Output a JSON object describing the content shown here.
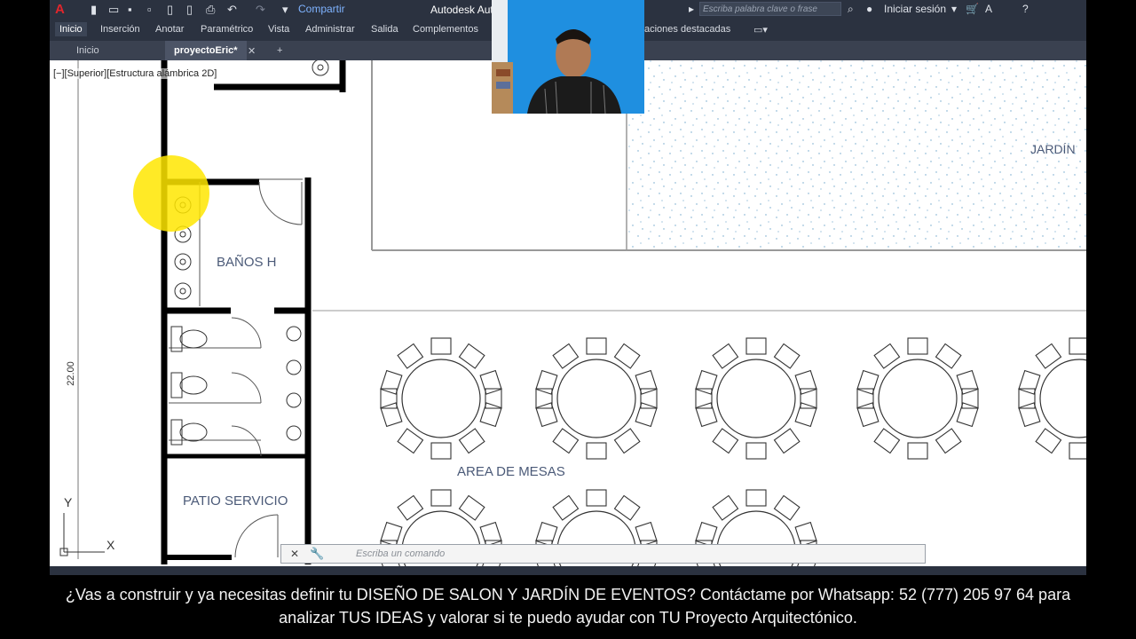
{
  "topbar": {
    "logo": "A",
    "share_label": "Compartir",
    "app_title": "Autodesk Auto",
    "search_placeholder": "Escriba palabra clave o frase",
    "signin_label": "Iniciar sesión"
  },
  "ribbon": {
    "tabs": [
      "Inicio",
      "Inserción",
      "Anotar",
      "Paramétrico",
      "Vista",
      "Administrar",
      "Salida",
      "Complementos",
      "aciones destacadas"
    ]
  },
  "doc_tabs": {
    "home": "Inicio",
    "active": "proyectoEric*",
    "close": "✕",
    "add": "+"
  },
  "viewport": {
    "label": "[−][Superior][Estructura alámbrica 2D]",
    "dimension": "22.00"
  },
  "rooms": {
    "banos": "BAÑOS H",
    "area_mesas": "AREA DE MESAS",
    "patio": "PATIO SERVICIO",
    "jardin": "JARDÍN"
  },
  "ucs": {
    "x": "X",
    "y": "Y"
  },
  "command_line": {
    "placeholder": "Escriba un comando"
  },
  "caption": {
    "line1": "¿Vas a construir y ya necesitas definir tu DISEÑO DE SALON Y JARDÍN DE EVENTOS? Contáctame por Whatsapp: 52 (777) 205 97 64 para",
    "line2": "analizar TUS IDEAS y valorar si te puedo ayudar con TU Proyecto Arquitectónico."
  },
  "colors": {
    "chrome": "#2b3240",
    "highlight": "#ffe600",
    "room_text": "#4b5a78"
  }
}
